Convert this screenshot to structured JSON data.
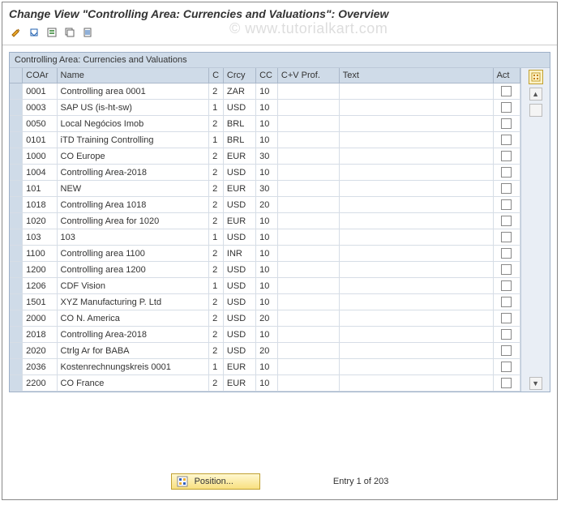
{
  "title": "Change View \"Controlling Area: Currencies and Valuations\": Overview",
  "watermark": "© www.tutorialkart.com",
  "panel_title": "Controlling Area: Currencies and Valuations",
  "columns": {
    "coar": "COAr",
    "name": "Name",
    "c": "C",
    "crcy": "Crcy",
    "cc": "CC",
    "cv": "C+V Prof.",
    "text": "Text",
    "act": "Act"
  },
  "rows": [
    {
      "coar": "0001",
      "name": "Controlling area 0001",
      "c": "2",
      "crcy": "ZAR",
      "cc": "10",
      "cv": "",
      "text": "",
      "act": false
    },
    {
      "coar": "0003",
      "name": "SAP US (is-ht-sw)",
      "c": "1",
      "crcy": "USD",
      "cc": "10",
      "cv": "",
      "text": "",
      "act": false
    },
    {
      "coar": "0050",
      "name": "Local Negócios Imob",
      "c": "2",
      "crcy": "BRL",
      "cc": "10",
      "cv": "",
      "text": "",
      "act": false
    },
    {
      "coar": "0101",
      "name": "iTD Training Controlling",
      "c": "1",
      "crcy": "BRL",
      "cc": "10",
      "cv": "",
      "text": "",
      "act": false
    },
    {
      "coar": "1000",
      "name": "CO Europe",
      "c": "2",
      "crcy": "EUR",
      "cc": "30",
      "cv": "",
      "text": "",
      "act": false
    },
    {
      "coar": "1004",
      "name": "Controlling Area-2018",
      "c": "2",
      "crcy": "USD",
      "cc": "10",
      "cv": "",
      "text": "",
      "act": false
    },
    {
      "coar": "101",
      "name": "NEW",
      "c": "2",
      "crcy": "EUR",
      "cc": "30",
      "cv": "",
      "text": "",
      "act": false
    },
    {
      "coar": "1018",
      "name": "Controlling Area 1018",
      "c": "2",
      "crcy": "USD",
      "cc": "20",
      "cv": "",
      "text": "",
      "act": false
    },
    {
      "coar": "1020",
      "name": "Controlling Area for 1020",
      "c": "2",
      "crcy": "EUR",
      "cc": "10",
      "cv": "",
      "text": "",
      "act": false
    },
    {
      "coar": "103",
      "name": "103",
      "c": "1",
      "crcy": "USD",
      "cc": "10",
      "cv": "",
      "text": "",
      "act": false
    },
    {
      "coar": "1100",
      "name": "Controlling area 1100",
      "c": "2",
      "crcy": "INR",
      "cc": "10",
      "cv": "",
      "text": "",
      "act": false
    },
    {
      "coar": "1200",
      "name": "Controlling area 1200",
      "c": "2",
      "crcy": "USD",
      "cc": "10",
      "cv": "",
      "text": "",
      "act": false
    },
    {
      "coar": "1206",
      "name": "CDF Vision",
      "c": "1",
      "crcy": "USD",
      "cc": "10",
      "cv": "",
      "text": "",
      "act": false
    },
    {
      "coar": "1501",
      "name": "XYZ Manufacturing P. Ltd",
      "c": "2",
      "crcy": "USD",
      "cc": "10",
      "cv": "",
      "text": "",
      "act": false
    },
    {
      "coar": "2000",
      "name": "CO N. America",
      "c": "2",
      "crcy": "USD",
      "cc": "20",
      "cv": "",
      "text": "",
      "act": false
    },
    {
      "coar": "2018",
      "name": "Controlling Area-2018",
      "c": "2",
      "crcy": "USD",
      "cc": "10",
      "cv": "",
      "text": "",
      "act": false
    },
    {
      "coar": "2020",
      "name": "Ctrlg Ar for BABA",
      "c": "2",
      "crcy": "USD",
      "cc": "20",
      "cv": "",
      "text": "",
      "act": false
    },
    {
      "coar": "2036",
      "name": "Kostenrechnungskreis 0001",
      "c": "1",
      "crcy": "EUR",
      "cc": "10",
      "cv": "",
      "text": "",
      "act": false
    },
    {
      "coar": "2200",
      "name": "CO France",
      "c": "2",
      "crcy": "EUR",
      "cc": "10",
      "cv": "",
      "text": "",
      "act": false
    }
  ],
  "footer": {
    "position_label": "Position...",
    "entry_text": "Entry 1 of 203"
  }
}
